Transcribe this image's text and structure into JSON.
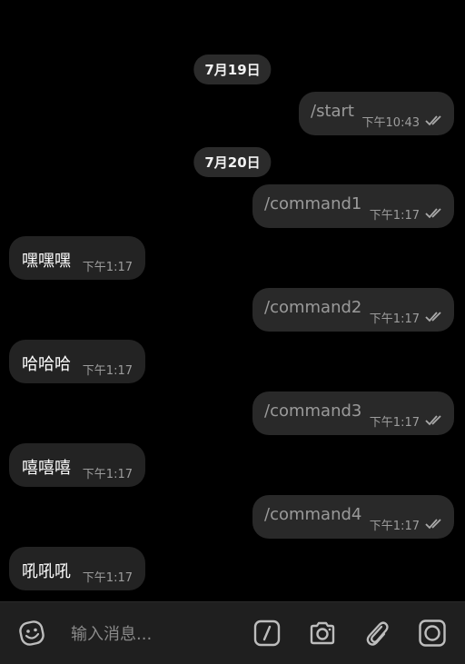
{
  "dates": [
    {
      "label": "7月19日"
    },
    {
      "label": "7月20日"
    }
  ],
  "messages": [
    {
      "dir": "out",
      "text": "/start",
      "time": "下午10:43",
      "status": "read-double-check"
    },
    {
      "dir": "out",
      "text": "/command1",
      "time": "下午1:17",
      "status": "read-double-check"
    },
    {
      "dir": "in",
      "text": "嘿嘿嘿",
      "time": "下午1:17"
    },
    {
      "dir": "out",
      "text": "/command2",
      "time": "下午1:17",
      "status": "read-double-check"
    },
    {
      "dir": "in",
      "text": "哈哈哈",
      "time": "下午1:17"
    },
    {
      "dir": "out",
      "text": "/command3",
      "time": "下午1:17",
      "status": "read-double-check"
    },
    {
      "dir": "in",
      "text": "嘻嘻嘻",
      "time": "下午1:17"
    },
    {
      "dir": "out",
      "text": "/command4",
      "time": "下午1:17",
      "status": "read-double-check"
    },
    {
      "dir": "in",
      "text": "吼吼吼",
      "time": "下午1:17"
    }
  ],
  "composer": {
    "placeholder": "输入消息...",
    "icons": [
      "emoji-icon",
      "bot-command-icon",
      "camera-icon",
      "attach-icon",
      "video-message-icon"
    ]
  },
  "colors": {
    "background": "#000000",
    "bubble_out": "#292929",
    "bubble_in": "#232323",
    "composer": "#1f1f1f"
  }
}
